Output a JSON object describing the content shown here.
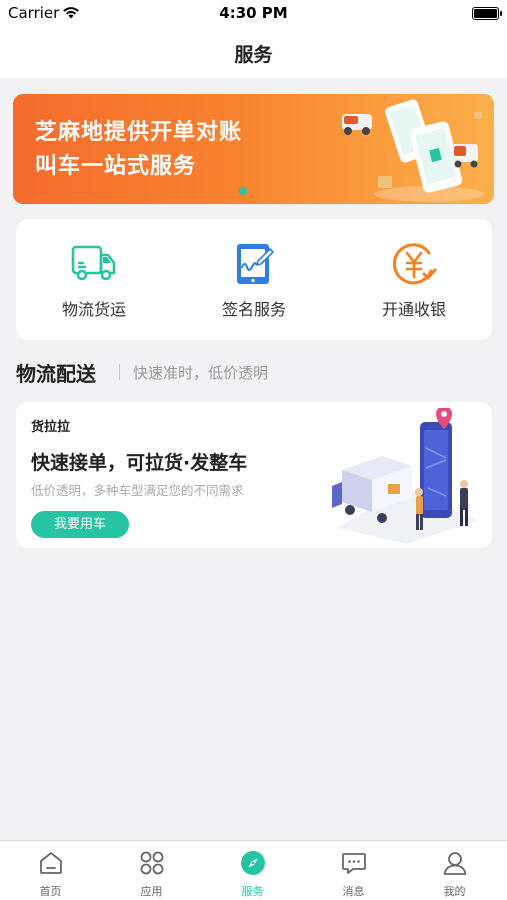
{
  "status_bar": {
    "carrier": "Carrier",
    "time": "4:30 PM"
  },
  "nav": {
    "title": "服务"
  },
  "banner": {
    "line1": "芝麻地提供开单对账",
    "line2": "叫车一站式服务",
    "page_indicator": {
      "current": 1,
      "total": 1
    }
  },
  "services": [
    {
      "label": "物流货运",
      "icon": "truck-icon"
    },
    {
      "label": "签名服务",
      "icon": "signature-tablet-icon"
    },
    {
      "label": "开通收银",
      "icon": "yuan-coin-icon"
    }
  ],
  "section": {
    "title": "物流配送",
    "subtitle": "快速准时，低价透明"
  },
  "delivery": {
    "brand": "货拉拉",
    "headline": "快速接单，可拉货·发整车",
    "description": "低价透明，多种车型满足您的不同需求",
    "button_label": "我要用车"
  },
  "tabs": [
    {
      "label": "首页",
      "icon": "home-icon",
      "active": false
    },
    {
      "label": "应用",
      "icon": "apps-icon",
      "active": false
    },
    {
      "label": "服务",
      "icon": "compass-icon",
      "active": true
    },
    {
      "label": "消息",
      "icon": "message-icon",
      "active": false
    },
    {
      "label": "我的",
      "icon": "profile-icon",
      "active": false
    }
  ],
  "colors": {
    "accent": "#27c4a4",
    "banner_start": "#f56b2e",
    "banner_end": "#fbb04a",
    "service_orange": "#f5821f",
    "service_blue": "#2f7fe3"
  }
}
